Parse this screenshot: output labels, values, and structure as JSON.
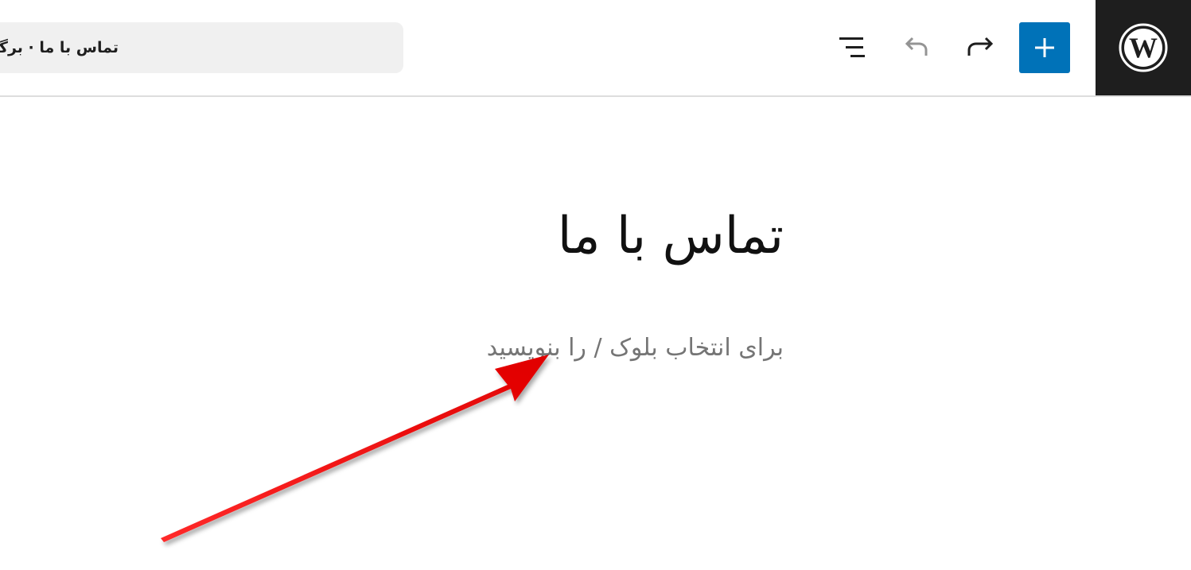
{
  "header": {
    "document_title": "تماس با ما · برگه",
    "icons": {
      "logo": "wordpress-logo-icon",
      "add": "plus-icon",
      "redo": "redo-icon",
      "undo": "undo-icon",
      "outline": "list-view-icon"
    },
    "undo_enabled": false,
    "redo_enabled": true
  },
  "editor": {
    "page_title": "تماس با ما",
    "block_placeholder": "برای انتخاب بلوک / را بنویسید"
  },
  "annotation": {
    "shape": "arrow",
    "color": "#e00000"
  },
  "colors": {
    "accent": "#0072b8",
    "logo_background": "#1e1e1e",
    "title_bar_background": "#f0f0f0"
  }
}
